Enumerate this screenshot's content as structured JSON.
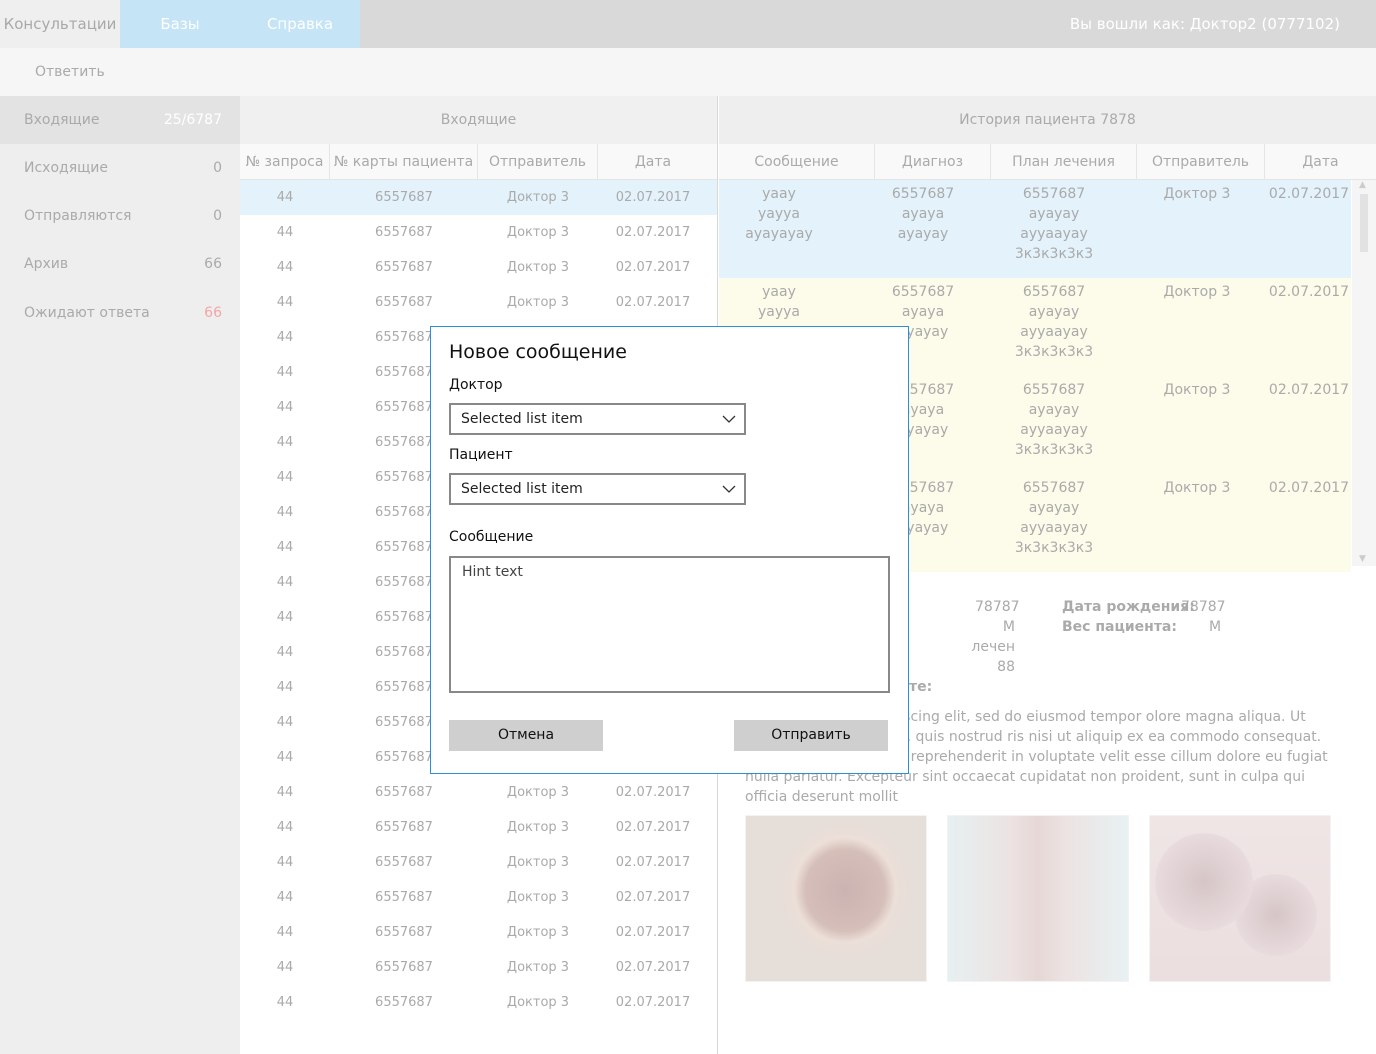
{
  "topbar": {
    "tabs": [
      "Консультации",
      "Базы",
      "Справка"
    ],
    "user": "Вы вошли как: Доктор2 (0777102)"
  },
  "toolbar": {
    "reply": "Ответить"
  },
  "sidebar": {
    "items": [
      {
        "label": "Входящие",
        "count": "25/6787"
      },
      {
        "label": "Исходящие",
        "count": "0"
      },
      {
        "label": "Отправляются",
        "count": "0"
      },
      {
        "label": "Архив",
        "count": "66"
      },
      {
        "label": "Ожидают ответа",
        "count": "66"
      }
    ]
  },
  "inbox": {
    "title": "Входящие",
    "columns": [
      "№ запроса",
      "№ карты пациента",
      "Отправитель",
      "Дата"
    ],
    "rows": [
      [
        "44",
        "6557687",
        "Доктор 3",
        "02.07.2017"
      ],
      [
        "44",
        "6557687",
        "Доктор 3",
        "02.07.2017"
      ],
      [
        "44",
        "6557687",
        "Доктор 3",
        "02.07.2017"
      ],
      [
        "44",
        "6557687",
        "Доктор 3",
        "02.07.2017"
      ],
      [
        "44",
        "6557687",
        "",
        ""
      ],
      [
        "44",
        "6557687",
        "",
        ""
      ],
      [
        "44",
        "6557687",
        "",
        ""
      ],
      [
        "44",
        "6557687",
        "",
        ""
      ],
      [
        "44",
        "6557687",
        "",
        ""
      ],
      [
        "44",
        "6557687",
        "",
        ""
      ],
      [
        "44",
        "6557687",
        "",
        ""
      ],
      [
        "44",
        "6557687",
        "",
        ""
      ],
      [
        "44",
        "6557687",
        "",
        ""
      ],
      [
        "44",
        "6557687",
        "",
        ""
      ],
      [
        "44",
        "6557687",
        "",
        ""
      ],
      [
        "44",
        "6557687",
        "",
        ""
      ],
      [
        "44",
        "6557687",
        "",
        ""
      ],
      [
        "44",
        "6557687",
        "Доктор 3",
        "02.07.2017"
      ],
      [
        "44",
        "6557687",
        "Доктор 3",
        "02.07.2017"
      ],
      [
        "44",
        "6557687",
        "Доктор 3",
        "02.07.2017"
      ],
      [
        "44",
        "6557687",
        "Доктор 3",
        "02.07.2017"
      ],
      [
        "44",
        "6557687",
        "Доктор 3",
        "02.07.2017"
      ],
      [
        "44",
        "6557687",
        "Доктор 3",
        "02.07.2017"
      ],
      [
        "44",
        "6557687",
        "Доктор 3",
        "02.07.2017"
      ]
    ]
  },
  "history": {
    "title": "История пациента 7878",
    "columns": [
      "Сообщение",
      "Диагноз",
      "План лечения",
      "Отправитель",
      "Дата"
    ],
    "rows": [
      {
        "message": [
          "yaay",
          "yayya",
          "ayayayay"
        ],
        "diagnosis": [
          "6557687",
          "ayaya",
          "ayayay"
        ],
        "plan": [
          "6557687",
          "ayayay",
          "ayyaayay",
          "3к3к3к3к3"
        ],
        "sender": "Доктор 3",
        "date": "02.07.2017"
      },
      {
        "message": [
          "yaay",
          "yayya"
        ],
        "diagnosis": [
          "6557687",
          "ayaya",
          "ayayay"
        ],
        "plan": [
          "6557687",
          "ayayay",
          "ayyaayay",
          "3к3к3к3к3"
        ],
        "sender": "Доктор 3",
        "date": "02.07.2017"
      },
      {
        "message": [],
        "diagnosis": [
          "6557687",
          "ayaya",
          "ayayay"
        ],
        "plan": [
          "6557687",
          "ayayay",
          "ayyaayay",
          "3к3к3к3к3"
        ],
        "sender": "Доктор 3",
        "date": "02.07.2017"
      },
      {
        "message": [],
        "diagnosis": [
          "6557687",
          "ayaya",
          "ayayay"
        ],
        "plan": [
          "6557687",
          "ayayay",
          "ayyaayay",
          "3к3к3к3к3"
        ],
        "sender": "Доктор 3",
        "date": "02.07.2017"
      }
    ]
  },
  "details": {
    "left_values": [
      "78787",
      "M",
      "лечен",
      "88"
    ],
    "birth_label": "Дата рождения:",
    "birth_value": "78787",
    "weight_label": "Вес пациента:",
    "weight_value": "M",
    "section_suffix": "те:",
    "lorem": "met, consectetur adipiscing elit, sed do eiusmod tempor olore magna aliqua. Ut enim ad minim veniam, quis nostrud ris nisi ut aliquip ex ea commodo consequat. Duis aute irure dolor in reprehenderit in voluptate velit esse cillum dolore eu fugiat nulla pariatur. Excepteur sint occaecat cupidatat non proident, sunt in culpa qui officia deserunt mollit"
  },
  "modal": {
    "title": "Новое сообщение",
    "doctor_label": "Доктор",
    "doctor_value": "Selected list item",
    "patient_label": "Пациент",
    "patient_value": "Selected list item",
    "message_label": "Сообщение",
    "message_placeholder": "Hint text",
    "cancel": "Отмена",
    "send": "Отправить"
  },
  "colors": {
    "accent": "#2b8ed8",
    "tab_active": "#c5e4f6",
    "waiting_count": "#f4a5a5"
  }
}
